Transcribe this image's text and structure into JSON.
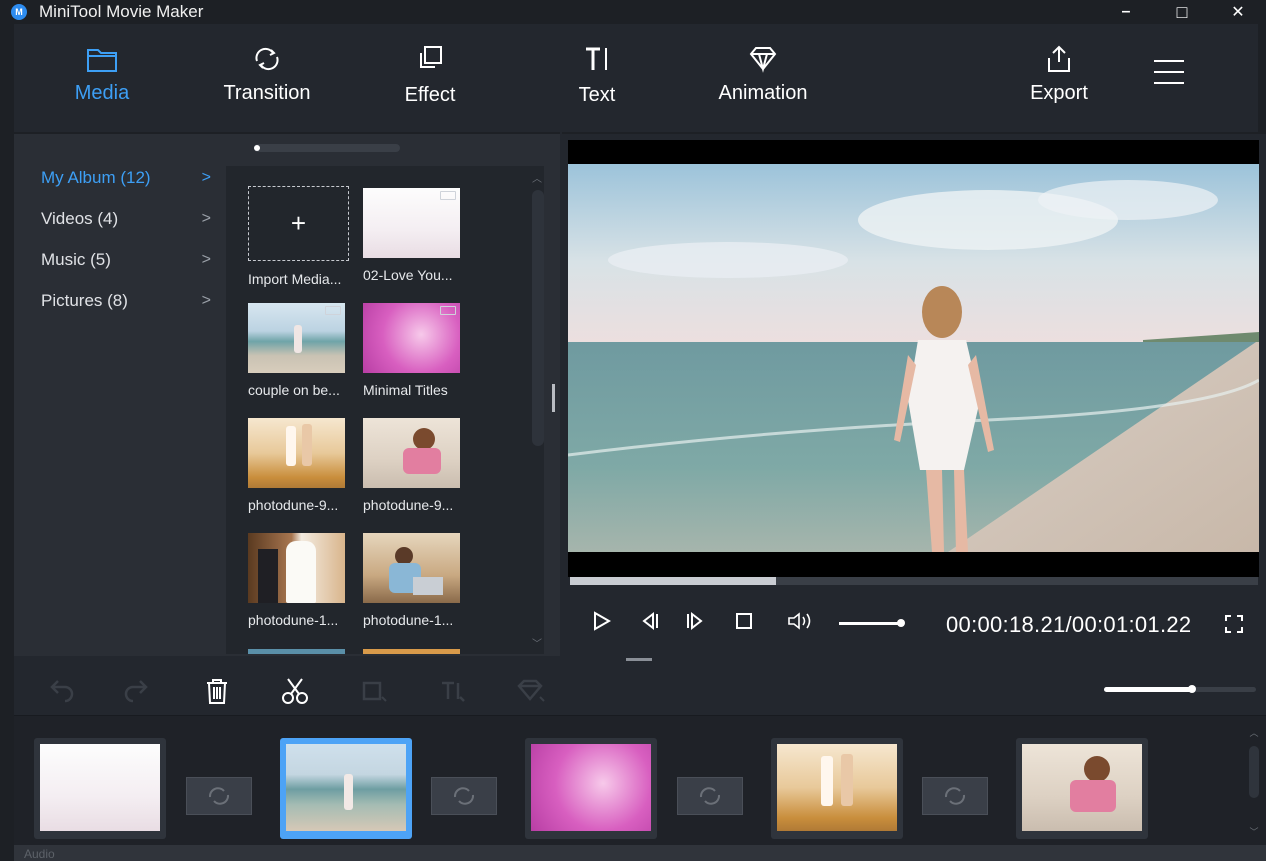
{
  "window": {
    "title": "MiniTool Movie Maker",
    "logo_letter": "M",
    "minimize": "–",
    "maximize": "□",
    "close": "✕"
  },
  "toolbar": {
    "media": "Media",
    "transition": "Transition",
    "effect": "Effect",
    "text": "Text",
    "animation": "Animation",
    "export": "Export",
    "accent_color": "#3d9ff5"
  },
  "albums": [
    {
      "label": "My Album (12)",
      "active": true
    },
    {
      "label": "Videos (4)",
      "active": false
    },
    {
      "label": "Music (5)",
      "active": false
    },
    {
      "label": "Pictures (8)",
      "active": false
    }
  ],
  "chevron": ">",
  "media_items": [
    {
      "label": "Import Media...",
      "kind": "import",
      "plus": "+"
    },
    {
      "label": "02-Love You...",
      "kind": "video"
    },
    {
      "label": "couple on be...",
      "kind": "video"
    },
    {
      "label": "Minimal Titles",
      "kind": "video"
    },
    {
      "label": "photodune-9...",
      "kind": "image"
    },
    {
      "label": "photodune-9...",
      "kind": "image"
    },
    {
      "label": "photodune-1...",
      "kind": "image"
    },
    {
      "label": "photodune-1...",
      "kind": "image"
    }
  ],
  "player": {
    "timecode": "00:00:18.21/00:01:01.22",
    "progress": 0.3,
    "volume": 1.0
  },
  "timeline": {
    "zoom": 0.58,
    "clips": [
      "white clip",
      "beach clip",
      "pink clip",
      "wedding clip",
      "sofa clip"
    ],
    "selected_clip": 1,
    "audio_label": "Audio"
  }
}
